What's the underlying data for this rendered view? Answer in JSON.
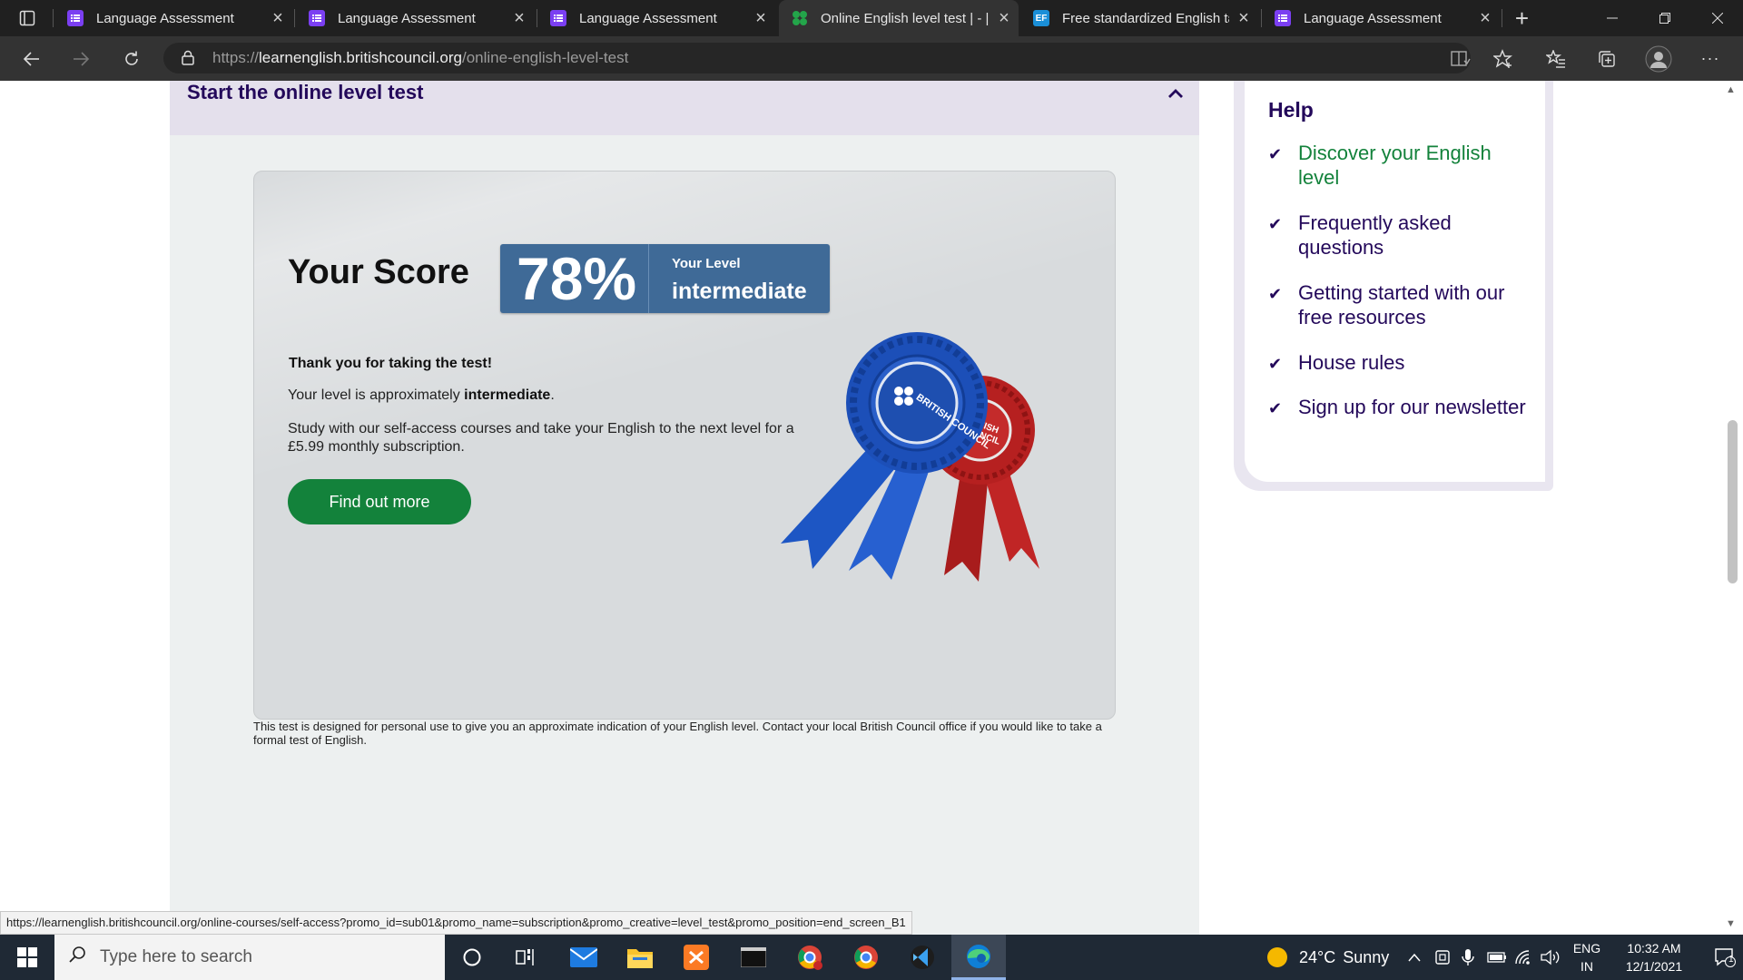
{
  "browser": {
    "tabs": [
      {
        "title": "Language Assessment",
        "favicon": "forms-icon",
        "active": false
      },
      {
        "title": "Language Assessment",
        "favicon": "forms-icon",
        "active": false
      },
      {
        "title": "Language Assessment",
        "favicon": "forms-icon",
        "active": false
      },
      {
        "title": "Online English level test | - |",
        "favicon": "british-council-icon",
        "active": true
      },
      {
        "title": "Free standardized English tε",
        "favicon": "ef-icon",
        "favicon_text": "EF",
        "active": false
      },
      {
        "title": "Language Assessment",
        "favicon": "forms-icon",
        "active": false
      }
    ],
    "url_prefix": "https://",
    "url_domain": "learnenglish.britishcouncil.org",
    "url_path": "/online-english-level-test",
    "status_url": "https://learnenglish.britishcouncil.org/online-courses/self-access?promo_id=sub01&promo_name=subscription&promo_creative=level_test&promo_position=end_screen_B1"
  },
  "page": {
    "section_title": "Start the online level test",
    "score_label": "Your Score",
    "score_value": "78%",
    "level_heading": "Your Level",
    "level_value": "intermediate",
    "thanks": "Thank you for taking the test!",
    "level_sentence_prefix": "Your level is approximately ",
    "level_sentence_value": "intermediate",
    "level_sentence_suffix": ".",
    "study_text": "Study with our self-access courses and take your English to the next level for a £5.99 monthly subscription.",
    "cta_label": "Find out more",
    "disclaimer": "This test is designed for personal use to give you an approximate indication of your English level. Contact your local British Council office if you would like to take a formal test of English.",
    "rosette_blue_text": "BRITISH COUNCIL",
    "rosette_red_text": "BRITISH COUNCIL"
  },
  "help": {
    "title": "Help",
    "items": [
      {
        "label": "Discover your English level",
        "color": "green"
      },
      {
        "label": "Frequently asked questions",
        "color": "purple"
      },
      {
        "label": "Getting started with our free resources",
        "color": "purple"
      },
      {
        "label": "House rules",
        "color": "purple"
      },
      {
        "label": "Sign up for our newsletter",
        "color": "purple"
      }
    ]
  },
  "taskbar": {
    "search_placeholder": "Type here to search",
    "weather_temp": "24°C",
    "weather_desc": "Sunny",
    "lang_top": "ENG",
    "lang_bottom": "IN",
    "time": "10:32 AM",
    "date": "12/1/2021",
    "notification_count": "1"
  },
  "colors": {
    "brand_purple": "#23085a",
    "brand_green": "#13823b",
    "score_blue": "#3f6a97",
    "rosette_blue": "#1c4fb8",
    "rosette_red": "#b62020"
  }
}
